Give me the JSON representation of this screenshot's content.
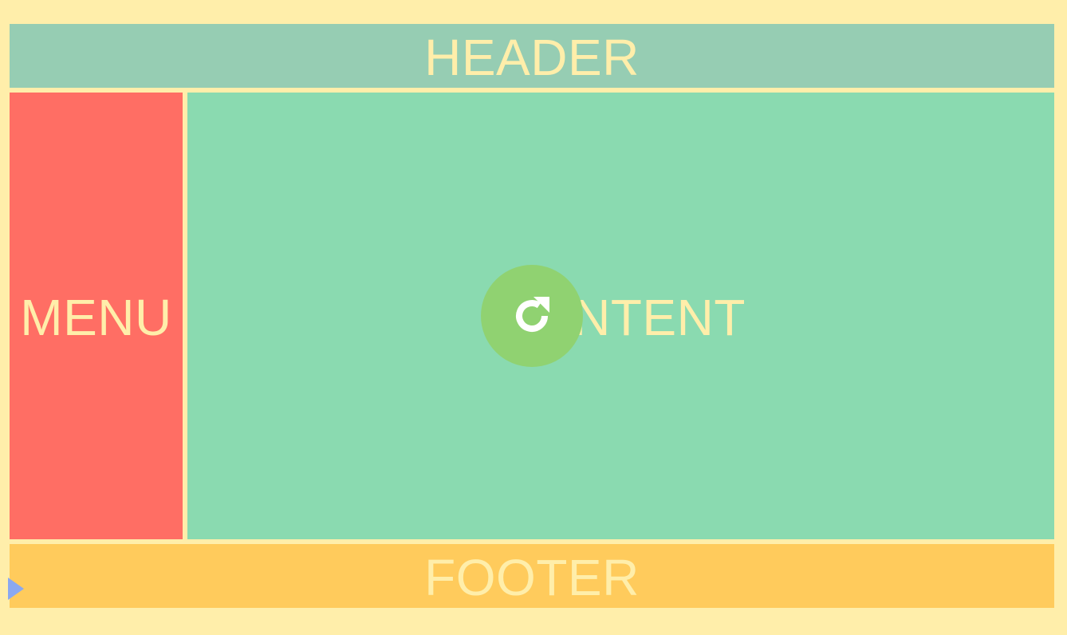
{
  "header": {
    "label": "HEADER"
  },
  "menu": {
    "label": "MENU"
  },
  "content": {
    "label": "CONTENT"
  },
  "footer": {
    "label": "FOOTER"
  },
  "overlay": {
    "icon": "reload-icon"
  },
  "colors": {
    "background": "#FFEEAA",
    "header": "#96CDB3",
    "menu": "#FF6E64",
    "content": "#8ADAB0",
    "footer": "#FFCB5C",
    "label_text": "#FFEEAA",
    "reload_button": "#90D271",
    "cursor": "#8AA8F0"
  }
}
